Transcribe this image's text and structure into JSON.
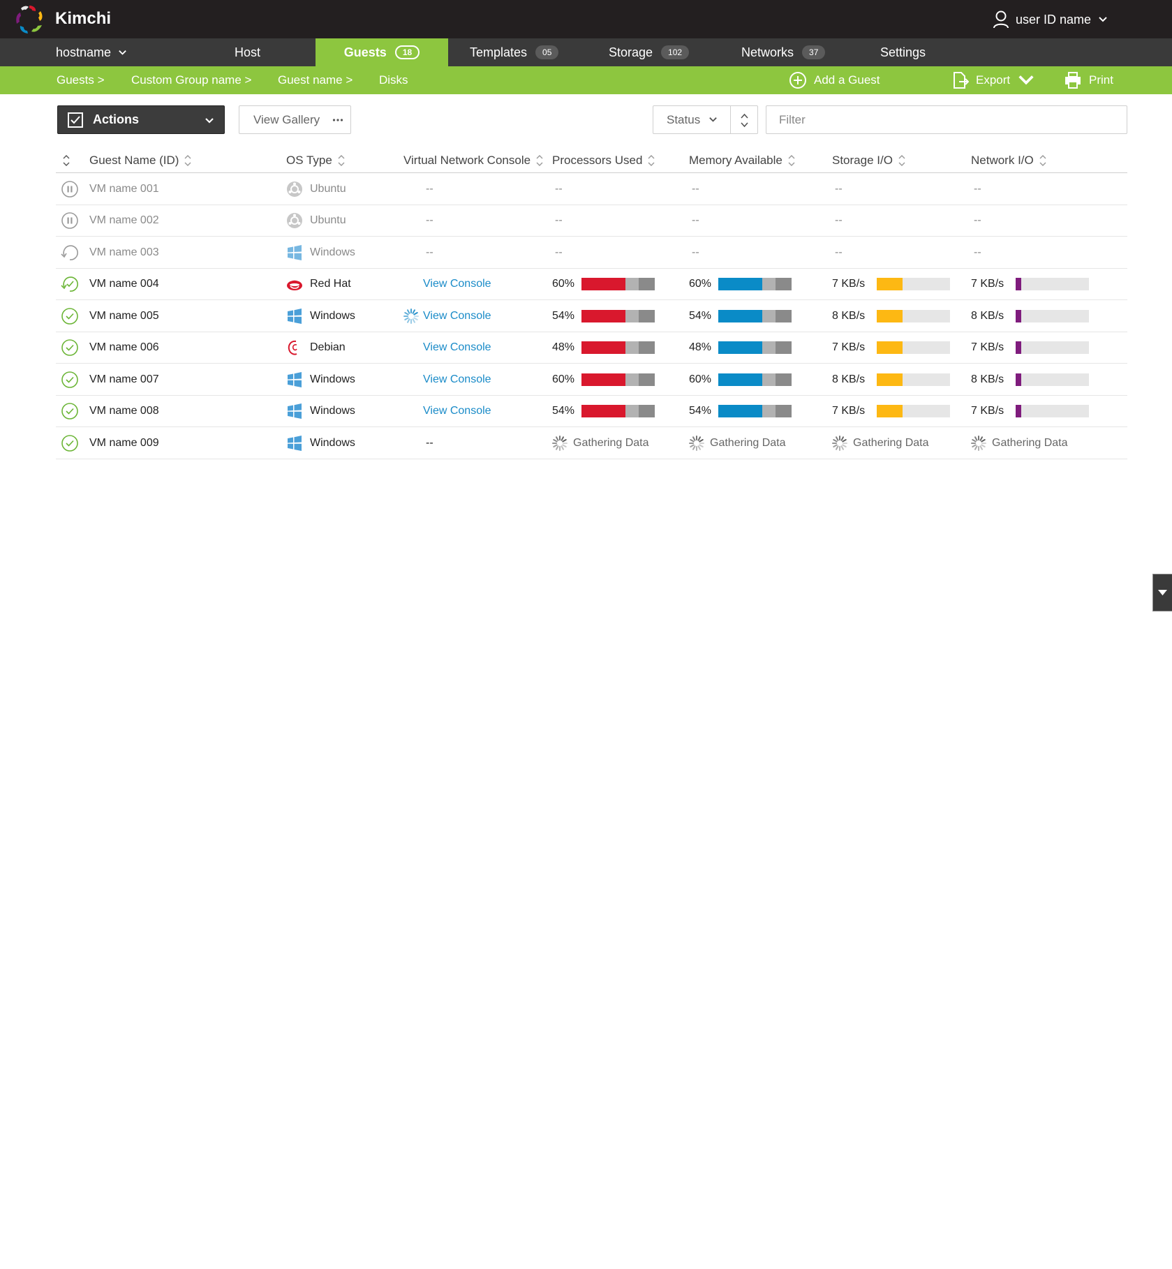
{
  "app": {
    "name": "Kimchi"
  },
  "user": {
    "label": "user ID name"
  },
  "nav": {
    "hostname": "hostname",
    "items": [
      {
        "label": "Host"
      },
      {
        "label": "Guests",
        "count": "18"
      },
      {
        "label": "Templates",
        "count": "05"
      },
      {
        "label": "Storage",
        "count": "102"
      },
      {
        "label": "Networks",
        "count": "37"
      },
      {
        "label": "Settings"
      }
    ]
  },
  "breadcrumb": [
    "Guests >",
    "Custom Group name >",
    "Guest name >",
    "Disks"
  ],
  "page_actions": {
    "add": "Add a Guest",
    "export": "Export",
    "print": "Print"
  },
  "toolbar": {
    "actions_label": "Actions",
    "gallery_label": "View Gallery",
    "status_label": "Status",
    "filter_placeholder": "Filter"
  },
  "table": {
    "columns": [
      "Guest Name (ID)",
      "OS Type",
      "Virtual Network Console",
      "Processors Used",
      "Memory Available",
      "Storage I/O",
      "Network I/O"
    ],
    "rows": [
      {
        "state": "paused",
        "name": "VM name 001",
        "os": "Ubuntu",
        "os_icon": "ubuntu-icon",
        "console": "--",
        "cpu": "--",
        "mem": "--",
        "storage": "--",
        "network": "--"
      },
      {
        "state": "paused",
        "name": "VM name 002",
        "os": "Ubuntu",
        "os_icon": "ubuntu-icon",
        "console": "--",
        "cpu": "--",
        "mem": "--",
        "storage": "--",
        "network": "--"
      },
      {
        "state": "stopped",
        "name": "VM name 003",
        "os": "Windows",
        "os_icon": "windows-icon",
        "console": "--",
        "cpu": "--",
        "mem": "--",
        "storage": "--",
        "network": "--"
      },
      {
        "state": "starting",
        "name": "VM name 004",
        "os": "Red Hat",
        "os_icon": "redhat-icon",
        "console": "View Console",
        "cpu": "60%",
        "cpu_fill": 0.6,
        "mem": "60%",
        "mem_fill": 0.6,
        "storage": "7 KB/s",
        "storage_fill": 0.35,
        "network": "7 KB/s",
        "network_fill": 0.08
      },
      {
        "state": "running",
        "name": "VM name 005",
        "os": "Windows",
        "os_icon": "windows-icon",
        "console": "View Console",
        "console_loading": true,
        "cpu": "54%",
        "cpu_fill": 0.6,
        "mem": "54%",
        "mem_fill": 0.6,
        "storage": "8 KB/s",
        "storage_fill": 0.35,
        "network": "8 KB/s",
        "network_fill": 0.08
      },
      {
        "state": "running",
        "name": "VM name 006",
        "os": "Debian",
        "os_icon": "debian-icon",
        "console": "View Console",
        "cpu": "48%",
        "cpu_fill": 0.6,
        "mem": "48%",
        "mem_fill": 0.6,
        "storage": "7 KB/s",
        "storage_fill": 0.35,
        "network": "7 KB/s",
        "network_fill": 0.08
      },
      {
        "state": "running",
        "name": "VM name 007",
        "os": "Windows",
        "os_icon": "windows-icon",
        "console": "View Console",
        "cpu": "60%",
        "cpu_fill": 0.6,
        "mem": "60%",
        "mem_fill": 0.6,
        "storage": "8 KB/s",
        "storage_fill": 0.35,
        "network": "8 KB/s",
        "network_fill": 0.08
      },
      {
        "state": "running",
        "name": "VM name 008",
        "os": "Windows",
        "os_icon": "windows-icon",
        "console": "View Console",
        "cpu": "54%",
        "cpu_fill": 0.6,
        "mem": "54%",
        "mem_fill": 0.6,
        "storage": "7 KB/s",
        "storage_fill": 0.35,
        "network": "7 KB/s",
        "network_fill": 0.08
      },
      {
        "state": "running",
        "name": "VM name 009",
        "os": "Windows",
        "os_icon": "windows-icon",
        "console": "--",
        "cpu": "Gathering Data",
        "mem": "Gathering Data",
        "storage": "Gathering Data",
        "network": "Gathering Data",
        "gathering": true
      }
    ]
  },
  "colors": {
    "accent_green": "#8dc63f",
    "top_bar": "#231f20",
    "nav_bar": "#3a3a3a",
    "link_blue": "#1a8bc8",
    "cpu_bar": "#d9182d",
    "mem_bar": "#0a8bc7",
    "storage_bar": "#fdb813",
    "network_bar": "#7f1c7d"
  }
}
